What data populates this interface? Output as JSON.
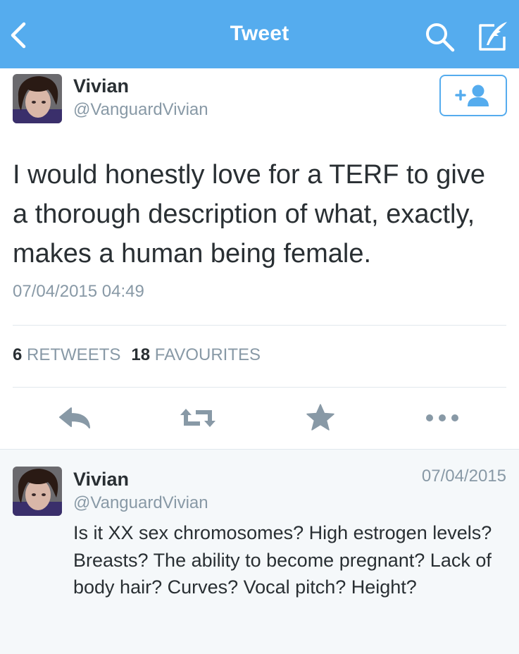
{
  "header": {
    "title": "Tweet",
    "back_icon": "chevron-left-icon",
    "search_icon": "search-icon",
    "compose_icon": "compose-icon",
    "bg_color": "#55acee"
  },
  "tweet": {
    "author_name": "Vivian",
    "author_handle": "@VanguardVivian",
    "text": "I would honestly love for a TERF to give a thorough description of what, exactly, makes a human being female.",
    "timestamp": "07/04/2015 04:49",
    "follow_icon": "add-user-icon",
    "retweets_count": "6",
    "retweets_label": "RETWEETS",
    "favourites_count": "18",
    "favourites_label": "FAVOURITES",
    "actions": [
      "reply-icon",
      "retweet-icon",
      "star-icon",
      "more-icon"
    ]
  },
  "reply": {
    "author_name": "Vivian",
    "author_handle": "@VanguardVivian",
    "date": "07/04/2015",
    "text": "Is it XX sex chromosomes? High estrogen levels? Breasts? The ability to become pregnant? Lack of body hair? Curves? Vocal pitch? Height?"
  },
  "colors": {
    "accent": "#55acee",
    "muted": "#8899a6",
    "text": "#292f33",
    "action_icon": "#8899a6"
  }
}
